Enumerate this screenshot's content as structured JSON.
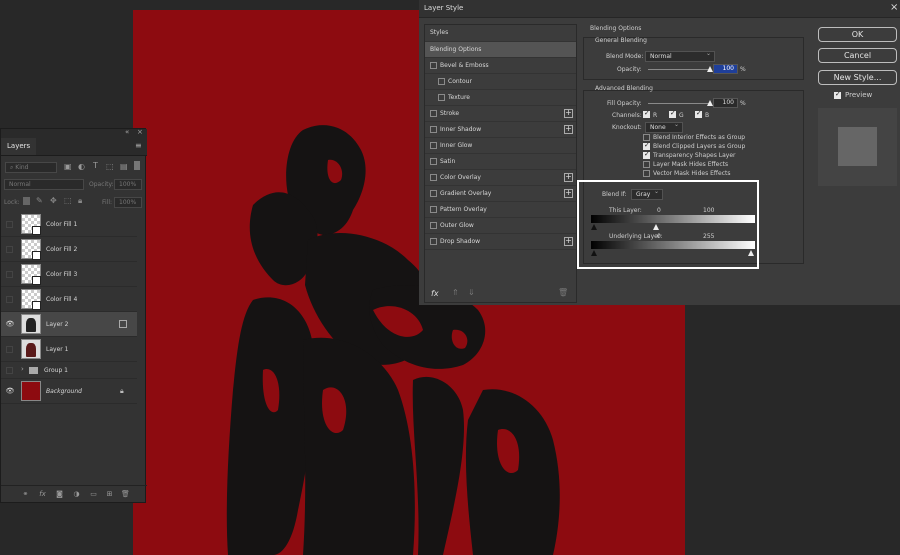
{
  "layers_panel": {
    "tab": "Layers",
    "filter_kind": "Kind",
    "blend_mode": "Normal",
    "opacity_label": "Opacity:",
    "opacity_value": "100%",
    "lock_label": "Lock:",
    "fill_label": "Fill:",
    "fill_value": "100%",
    "layers": [
      {
        "name": "Color Fill 1",
        "visible": false
      },
      {
        "name": "Color Fill 2",
        "visible": false
      },
      {
        "name": "Color Fill 3",
        "visible": false
      },
      {
        "name": "Color Fill 4",
        "visible": false
      },
      {
        "name": "Layer 2",
        "visible": true
      },
      {
        "name": "Layer 1",
        "visible": false
      },
      {
        "name": "Group 1",
        "visible": false
      },
      {
        "name": "Background",
        "visible": true
      }
    ]
  },
  "dialog": {
    "title": "Layer Style",
    "styles_header": "Styles",
    "styles": [
      {
        "label": "Blending Options"
      },
      {
        "label": "Bevel & Emboss"
      },
      {
        "label": "Contour"
      },
      {
        "label": "Texture"
      },
      {
        "label": "Stroke"
      },
      {
        "label": "Inner Shadow"
      },
      {
        "label": "Inner Glow"
      },
      {
        "label": "Satin"
      },
      {
        "label": "Color Overlay"
      },
      {
        "label": "Gradient Overlay"
      },
      {
        "label": "Pattern Overlay"
      },
      {
        "label": "Outer Glow"
      },
      {
        "label": "Drop Shadow"
      }
    ],
    "fx_label": "fx",
    "blending": {
      "section_title": "Blending Options",
      "general_title": "General Blending",
      "blend_mode_label": "Blend Mode:",
      "blend_mode_value": "Normal",
      "opacity_label": "Opacity:",
      "opacity_value": "100",
      "opacity_level": 1.0,
      "percent": "%",
      "advanced_title": "Advanced Blending",
      "fill_opacity_label": "Fill Opacity:",
      "fill_opacity_value": "100",
      "channels_label": "Channels:",
      "channel_r": "R",
      "channel_g": "G",
      "channel_b": "B",
      "knockout_label": "Knockout:",
      "knockout_value": "None",
      "options": [
        {
          "label": "Blend Interior Effects as Group",
          "checked": false
        },
        {
          "label": "Blend Clipped Layers as Group",
          "checked": true
        },
        {
          "label": "Transparency Shapes Layer",
          "checked": true
        },
        {
          "label": "Layer Mask Hides Effects",
          "checked": false
        },
        {
          "label": "Vector Mask Hides Effects",
          "checked": false
        }
      ],
      "blend_if_label": "Blend If:",
      "blend_if_value": "Gray",
      "this_layer_label": "This Layer:",
      "this_layer_low": "0",
      "this_layer_high": "100",
      "underlying_label": "Underlying Layer:",
      "underlying_low": "0",
      "underlying_high": "255"
    },
    "buttons": {
      "ok": "OK",
      "cancel": "Cancel",
      "new_style": "New Style...",
      "preview": "Preview"
    }
  },
  "colors": {
    "canvas_red": "#8d0b10",
    "highlight": "#ffffff"
  }
}
